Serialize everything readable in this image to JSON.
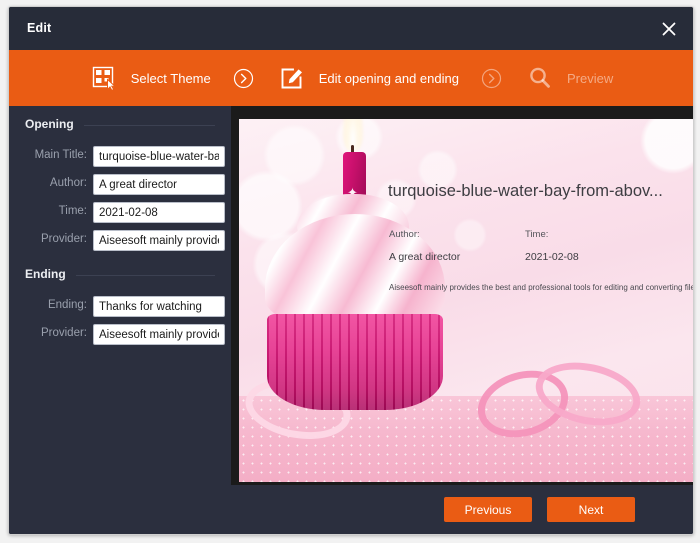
{
  "window": {
    "title": "Edit",
    "close_icon": "close-icon"
  },
  "colors": {
    "accent_orange": "#ea5c14",
    "titlebar": "#272c39",
    "panel": "#2b2f3e",
    "preview_backdrop": "#1b1b1b"
  },
  "stepbar": {
    "steps": [
      {
        "label": "Select Theme",
        "icon": "theme-grid-icon",
        "state": "active"
      },
      {
        "label": "Edit opening and ending",
        "icon": "edit-square-icon",
        "state": "active"
      },
      {
        "label": "Preview",
        "icon": "magnifier-icon",
        "state": "disabled"
      }
    ],
    "separator_icon": "chevron-right-circle-icon"
  },
  "sidebar": {
    "opening": {
      "heading": "Opening",
      "fields": [
        {
          "label": "Main Title:",
          "value": "turquoise-blue-water-ba",
          "name": "main-title"
        },
        {
          "label": "Author:",
          "value": "A great director",
          "name": "author"
        },
        {
          "label": "Time:",
          "value": "2021-02-08",
          "name": "time"
        },
        {
          "label": "Provider:",
          "value": "Aiseesoft mainly provide",
          "name": "provider"
        }
      ]
    },
    "ending": {
      "heading": "Ending",
      "fields": [
        {
          "label": "Ending:",
          "value": "Thanks for watching",
          "name": "ending"
        },
        {
          "label": "Provider:",
          "value": "Aiseesoft mainly provide",
          "name": "ending-provider"
        }
      ]
    }
  },
  "preview": {
    "title": "turquoise-blue-water-bay-from-abov...",
    "author_key": "Author:",
    "author_value": "A great director",
    "time_key": "Time:",
    "time_value": "2021-02-08",
    "description": "Aiseesoft mainly provides the best and professional tools for editing and converting files."
  },
  "footer": {
    "previous_label": "Previous",
    "next_label": "Next"
  }
}
